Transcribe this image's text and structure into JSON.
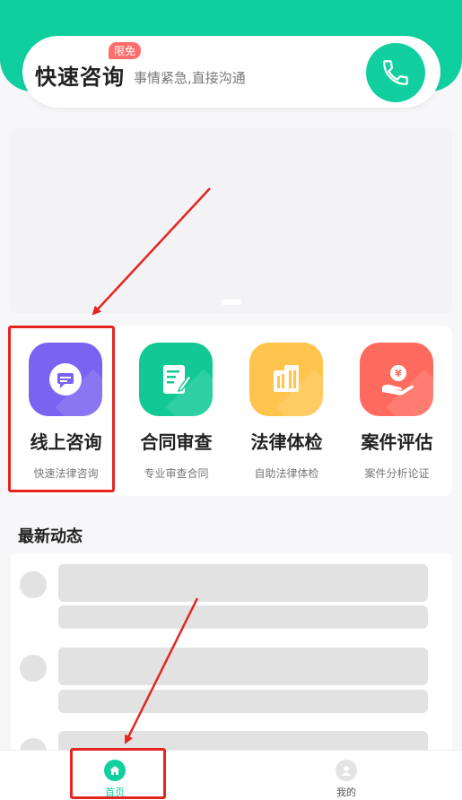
{
  "quick": {
    "title": "快速咨询",
    "badge": "限免",
    "subtitle": "事情紧急,直接沟通",
    "call_icon": "phone-icon"
  },
  "services": [
    {
      "name": "线上咨询",
      "desc": "快速法律咨询",
      "icon": "chat-icon",
      "color": "#7b63f1"
    },
    {
      "name": "合同审查",
      "desc": "专业审查合同",
      "icon": "contract-edit-icon",
      "color": "#12c996"
    },
    {
      "name": "法律体检",
      "desc": "自助法律体检",
      "icon": "building-icon",
      "color": "#ffc44d"
    },
    {
      "name": "案件评估",
      "desc": "案件分析论证",
      "icon": "money-hand-icon",
      "color": "#ff6a5e"
    }
  ],
  "news": {
    "title": "最新动态"
  },
  "tabbar": {
    "home": {
      "label": "首页",
      "icon": "home-icon",
      "color": "#12cf9f"
    },
    "mine": {
      "label": "我的",
      "icon": "user-icon",
      "color": "#555555"
    }
  },
  "colors": {
    "brand": "#0fcf9f",
    "annotation": "#e52521"
  }
}
